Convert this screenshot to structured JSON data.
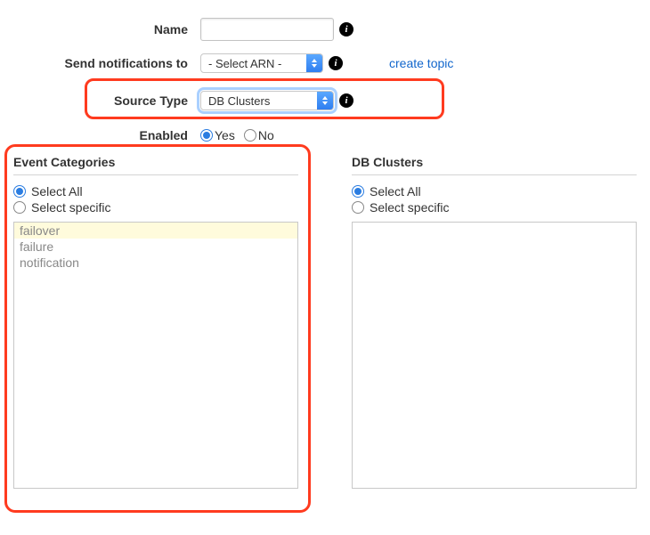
{
  "form": {
    "name": {
      "label": "Name",
      "value": ""
    },
    "notify": {
      "label": "Send notifications to",
      "selected": "- Select ARN -",
      "create_link": "create topic"
    },
    "source_type": {
      "label": "Source Type",
      "selected": "DB Clusters"
    },
    "enabled": {
      "label": "Enabled",
      "yes": "Yes",
      "no": "No"
    }
  },
  "left_panel": {
    "title": "Event Categories",
    "opt_all": "Select All",
    "opt_specific": "Select specific",
    "items": [
      "failover",
      "failure",
      "notification"
    ]
  },
  "right_panel": {
    "title": "DB Clusters",
    "opt_all": "Select All",
    "opt_specific": "Select specific"
  }
}
